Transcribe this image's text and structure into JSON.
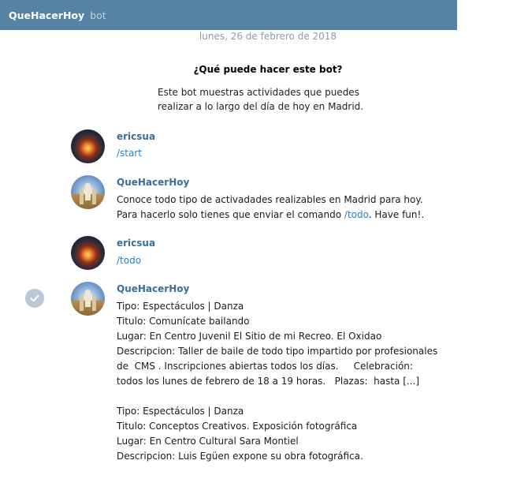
{
  "chat": {
    "title": "QueHacerHoy",
    "subtitle": "bot",
    "date": "lunes, 26 de febrero de 2018"
  },
  "intro": {
    "title": "¿Qué puede hacer este bot?",
    "line1": "Este bot muestras actividades que puedes",
    "line2": "realizar a lo largo del día de hoy en Madrid."
  },
  "messages": [
    {
      "sender": "ericsua",
      "lines": [
        "/start"
      ]
    },
    {
      "sender": "QueHacerHoy",
      "line1": "Conoce todo tipo de activadades realizables en Madrid para hoy.",
      "line2_pre": "Para hacerlo solo tienes que enviar el comando ",
      "line2_cmd": "/todo",
      "line2_post": ". Have fun!."
    },
    {
      "sender": "ericsua",
      "lines": [
        "/todo"
      ]
    },
    {
      "sender": "QueHacerHoy",
      "lines": [
        "Tipo: Espectáculos | Danza",
        "Titulo: Comunícate bailando",
        "Lugar: En Centro Juvenil El Sitio de mi Recreo. El Oxidao",
        "Descripcion: Taller de baile de todo tipo impartido por profesionales",
        "de  CMS . Inscripciones abiertas todos los días.     Celebración:",
        "todos los lunes de febrero de 18 a 19 horas.   Plazas:  hasta [...]",
        "",
        "Tipo: Espectáculos | Danza",
        "Titulo: Conceptos Creativos. Exposición fotográfica",
        "Lugar: En Centro Cultural Sara Montiel",
        "Descripcion: Luis Egüen expone su obra fotográfica."
      ]
    }
  ],
  "icons": {
    "selected": "check-circle-icon",
    "user_avatar": "sunset-avatar",
    "bot_avatar": "monument-avatar"
  },
  "colors": {
    "titlebar": "#5682a3",
    "sender_name": "#3a6d99",
    "command_link": "#2481cc"
  }
}
